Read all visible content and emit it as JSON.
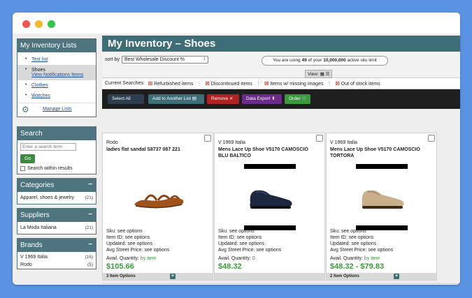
{
  "colors": {
    "background": "#5b93e3",
    "header_teal": "#3d6e77",
    "price_green": "#3a9a3a",
    "remove_red": "#b22222",
    "export_purple": "#6a2b8a"
  },
  "sidebar": {
    "inventory": {
      "title": "My Inventory Lists",
      "items": [
        {
          "label": "Test list"
        },
        {
          "label": "Shoes",
          "sub": "View Notifications Items"
        },
        {
          "label": "Clothes"
        },
        {
          "label": "Watches"
        }
      ],
      "manage_label": "Manage Lists",
      "manage_icon": "gear-icon"
    },
    "search": {
      "title": "Search",
      "placeholder": "Enter a search term",
      "go_label": "Go",
      "within_label": "Search within results"
    },
    "categories": {
      "title": "Categories",
      "items": [
        {
          "label": "Apparel, shoes & jewelry",
          "count": "(21)"
        }
      ]
    },
    "suppliers": {
      "title": "Suppliers",
      "items": [
        {
          "label": "La Moda Italiana",
          "count": "(21)"
        }
      ]
    },
    "brands": {
      "title": "Brands",
      "items": [
        {
          "label": "V 1969 Italia",
          "count": "(16)"
        },
        {
          "label": "Rodo",
          "count": "(5)"
        }
      ]
    }
  },
  "main": {
    "title": "My Inventory – Shoes",
    "sort_label": "sort by",
    "sort_value": "Best Wholesale Discount %",
    "usage": {
      "prefix": "You are using",
      "used": "49",
      "middle": "of your",
      "limit": "10,000,000",
      "suffix": "active sku limit"
    },
    "view_label": "View:",
    "current_searches_label": "Current Searches:",
    "current_searches": [
      "Refurbished items",
      "Discontinued items",
      "Items w/ missing images",
      "Out of stock items"
    ],
    "actions": {
      "select_all": "Select All",
      "add_to_list": "Add to Another List",
      "remove": "Remove",
      "export": "Data Export",
      "order": "Order"
    },
    "products": [
      {
        "brand": "Rodo",
        "name": "ladies flat sandal S8737 087 221",
        "sku": "Sku: see options",
        "item_id": "Item ID: see options",
        "updated": "Updated: see options",
        "avg_price": "Avg Street Price: see options",
        "avail_label": "Avail. Quantity:",
        "avail_value": "by item",
        "price": "$105.66",
        "options_label": "3 Item Options"
      },
      {
        "brand": "V 1969 Italia",
        "name": "Mens Lace Up Shoe V5170 CAMOSCIO BLU BALTICO",
        "sku": "Sku: see options",
        "item_id": "Item ID: see options",
        "updated": "Updated: see options",
        "avg_price": "Avg Street Price: see options",
        "avail_label": "Avail. Quantity:",
        "avail_value": "0",
        "price": "$48.32",
        "options_label": ""
      },
      {
        "brand": "V 1969 Italia",
        "name": "Mens Lace Up Shoe V5170 CAMOSCIO TORTORA",
        "sku": "Sku: see options",
        "item_id": "Item ID: see options",
        "updated": "Updated: see options",
        "avg_price": "Avg Street Price: see options",
        "avail_label": "Avail. Quantity:",
        "avail_value": "by item",
        "price": "$48.32 - $79.83",
        "options_label": "2 Item Options"
      }
    ]
  }
}
